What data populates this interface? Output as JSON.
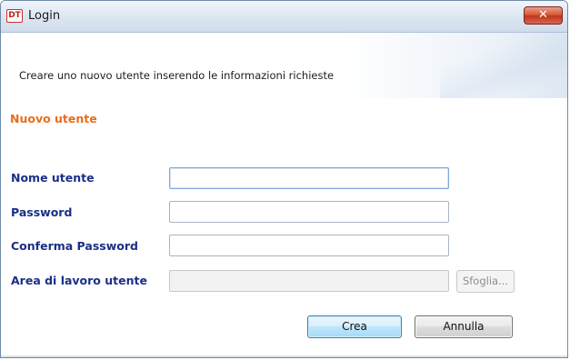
{
  "window": {
    "title": "Login",
    "app_icon_text": "DT",
    "close_icon": "close-icon",
    "close_symbol": "✕"
  },
  "header": {
    "description": "Creare uno nuovo utente inserendo le informazioni richieste"
  },
  "section": {
    "title": "Nuovo utente"
  },
  "form": {
    "username": {
      "label": "Nome utente",
      "value": ""
    },
    "password": {
      "label": "Password",
      "value": ""
    },
    "confirm_password": {
      "label": "Conferma Password",
      "value": ""
    },
    "workspace": {
      "label": "Area di lavoro utente",
      "value": "",
      "browse_label": "Sfoglia..."
    }
  },
  "actions": {
    "create_label": "Crea",
    "cancel_label": "Annulla"
  },
  "colors": {
    "section_title": "#e96c1c",
    "field_label": "#1b2f86",
    "close_button": "#c0321c"
  }
}
